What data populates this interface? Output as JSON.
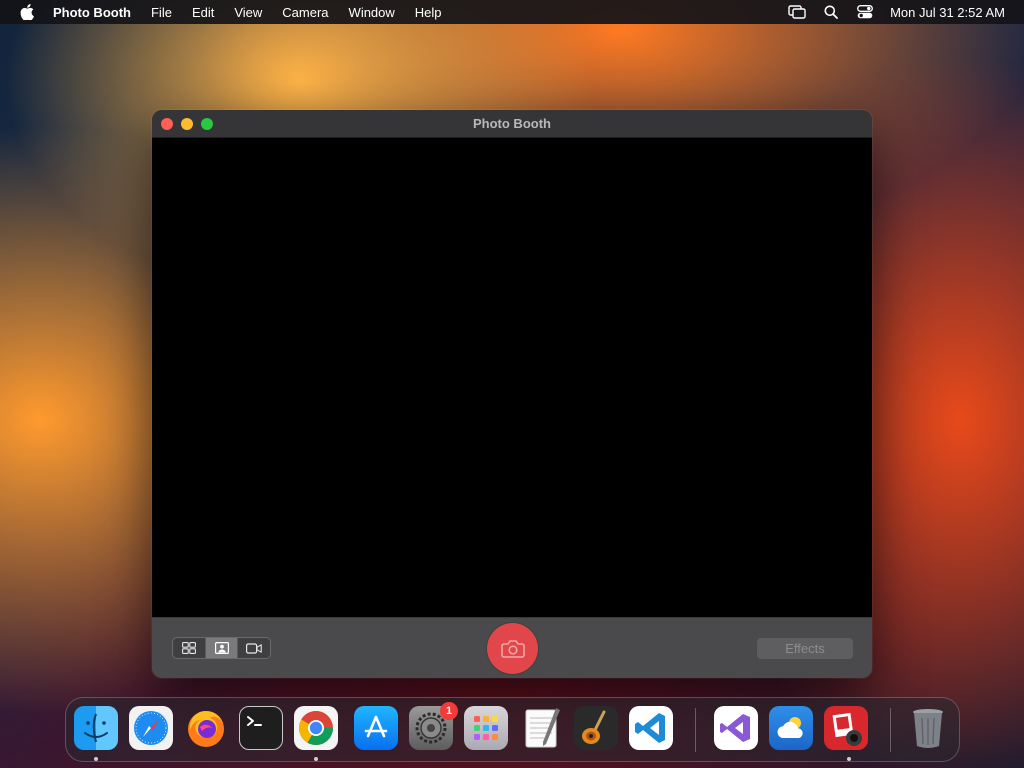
{
  "menubar": {
    "app_name": "Photo Booth",
    "menus": [
      "File",
      "Edit",
      "View",
      "Camera",
      "Window",
      "Help"
    ],
    "clock": "Mon Jul 31  2:52 AM"
  },
  "window": {
    "title": "Photo Booth",
    "modes": [
      "grid-icon",
      "portrait-icon",
      "video-icon"
    ],
    "selected_mode": "portrait-icon",
    "effects_label": "Effects"
  },
  "dock": {
    "apps": [
      "Finder",
      "Safari",
      "Firefox",
      "Terminal",
      "Chrome",
      "App Store",
      "System Settings",
      "Launchpad",
      "TextEdit",
      "GarageBand",
      "Visual Studio Code",
      "Visual Studio",
      "Weather",
      "Photo Booth",
      "Trash"
    ],
    "system_settings_badge": "1"
  },
  "colors": {
    "shutter": "#e0464a",
    "close": "#ff5f57",
    "minimize": "#febc2e",
    "maximize": "#28c840"
  }
}
